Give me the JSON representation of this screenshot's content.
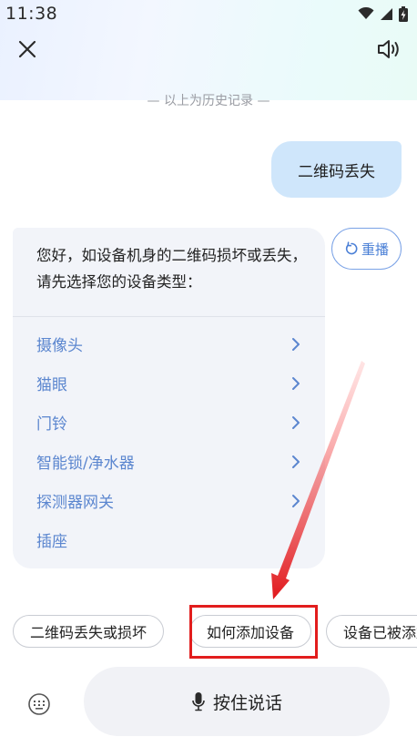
{
  "status_bar": {
    "time": "11:38",
    "icons": [
      "wifi-icon",
      "signal-icon",
      "battery-charging-icon"
    ]
  },
  "nav": {
    "close_icon": "close-icon",
    "sound_icon": "speaker-icon"
  },
  "history_divider": "— 以上为历史记录 —",
  "user_message": "二维码丢失",
  "bot_message": {
    "text": "您好，如设备机身的二维码损坏或丢失，请先选择您的设备类型：",
    "options": [
      {
        "label": "摄像头",
        "has_arrow": true
      },
      {
        "label": "猫眼",
        "has_arrow": true
      },
      {
        "label": "门铃",
        "has_arrow": true
      },
      {
        "label": "智能锁/净水器",
        "has_arrow": true
      },
      {
        "label": "探测器网关",
        "has_arrow": true
      },
      {
        "label": "插座",
        "has_arrow": false
      }
    ]
  },
  "replay_button": {
    "icon": "refresh-icon",
    "label": "重播"
  },
  "quick_replies": [
    "二维码丢失或损坏",
    "如何添加设备",
    "设备已被添加"
  ],
  "bottom_bar": {
    "keyboard_icon": "keyboard-icon",
    "voice_label": "按住说话",
    "mic_icon": "microphone-icon"
  },
  "colors": {
    "accent_blue": "#5b86cf",
    "user_bubble": "#cfe6fb",
    "annotation_red": "#e21d1d"
  }
}
